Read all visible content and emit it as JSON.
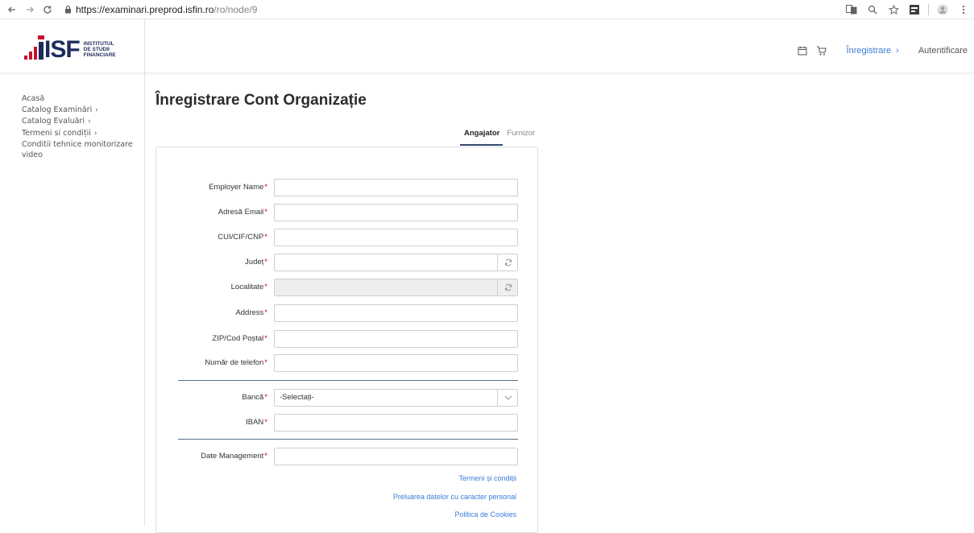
{
  "browser": {
    "url_host": "https://examinari.preprod.isfin.ro",
    "url_path": "/ro/node/9"
  },
  "header": {
    "logo_text": "ISF",
    "logo_sub": [
      "INSTITUTUL",
      "DE STUDII",
      "FINANCIARE"
    ],
    "register_label": "Înregistrare",
    "login_label": "Autentificare"
  },
  "sidebar": {
    "items": [
      {
        "label": "Acasă",
        "chevron": ""
      },
      {
        "label": "Catalog Examinări",
        "chevron": "›"
      },
      {
        "label": "Catalog Evaluări",
        "chevron": "›"
      },
      {
        "label": "Termeni si condiții",
        "chevron": "›"
      },
      {
        "label": "Conditii tehnice monitorizare video",
        "chevron": ""
      }
    ]
  },
  "page": {
    "title": "Înregistrare Cont Organizație",
    "tabs": [
      {
        "label": "Angajator",
        "active": true
      },
      {
        "label": "Furnizor",
        "active": false
      }
    ]
  },
  "form": {
    "fields": [
      {
        "label": "Employer Name",
        "value": ""
      },
      {
        "label": "Adresă Email",
        "value": ""
      },
      {
        "label": "CUI/CIF/CNP",
        "value": ""
      },
      {
        "label": "Județ",
        "value": ""
      },
      {
        "label": "Localitate",
        "value": ""
      },
      {
        "label": "Address",
        "value": ""
      },
      {
        "label": "ZIP/Cod Poștal",
        "value": ""
      },
      {
        "label": "Număr de telefon",
        "value": ""
      },
      {
        "label": "Bancă",
        "value": "-Selectați-"
      },
      {
        "label": "IBAN",
        "value": ""
      },
      {
        "label": "Date Management",
        "value": ""
      }
    ],
    "required_mark": "*",
    "links": [
      "Termeni și condiții",
      "Preluarea datelor cu caracter personal",
      "Politica de Cookies"
    ]
  },
  "colors": {
    "brand_navy": "#1d2b5c",
    "brand_red": "#c8102e",
    "link_blue": "#3a7bd5",
    "required_red": "#d0021b"
  }
}
